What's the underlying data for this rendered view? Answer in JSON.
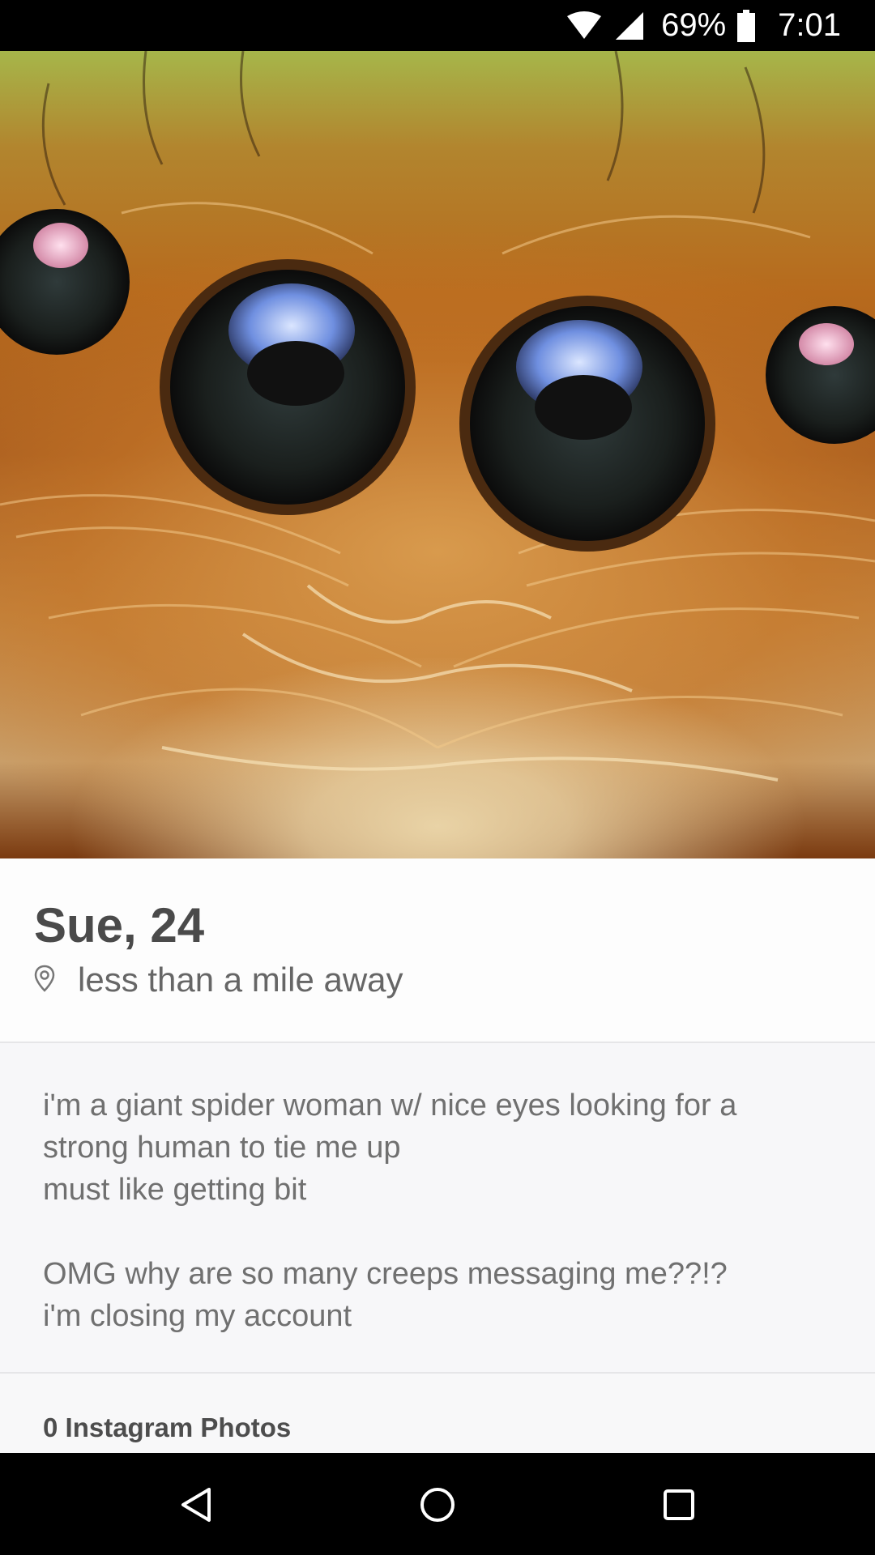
{
  "status_bar": {
    "battery_percent": "69%",
    "time": "7:01",
    "icons": [
      "wifi-icon",
      "cell-signal-icon",
      "battery-icon"
    ]
  },
  "photo": {
    "description_icon": "profile-photo"
  },
  "profile": {
    "name_age": "Sue, 24",
    "distance": "less than a mile away",
    "bio_lines": [
      "i'm a giant spider woman w/ nice eyes looking for a",
      "strong human to tie me up",
      "must like getting bit",
      "",
      "OMG why are so many creeps messaging me??!?",
      "i'm closing my account"
    ],
    "instagram": "0 Instagram Photos"
  },
  "nav_bar": {
    "buttons": [
      "back-icon",
      "home-icon",
      "recents-icon"
    ]
  },
  "colors": {
    "name_text": "#4a4a4a",
    "body_text": "#707070",
    "panel_bg": "#f8f8f9"
  }
}
